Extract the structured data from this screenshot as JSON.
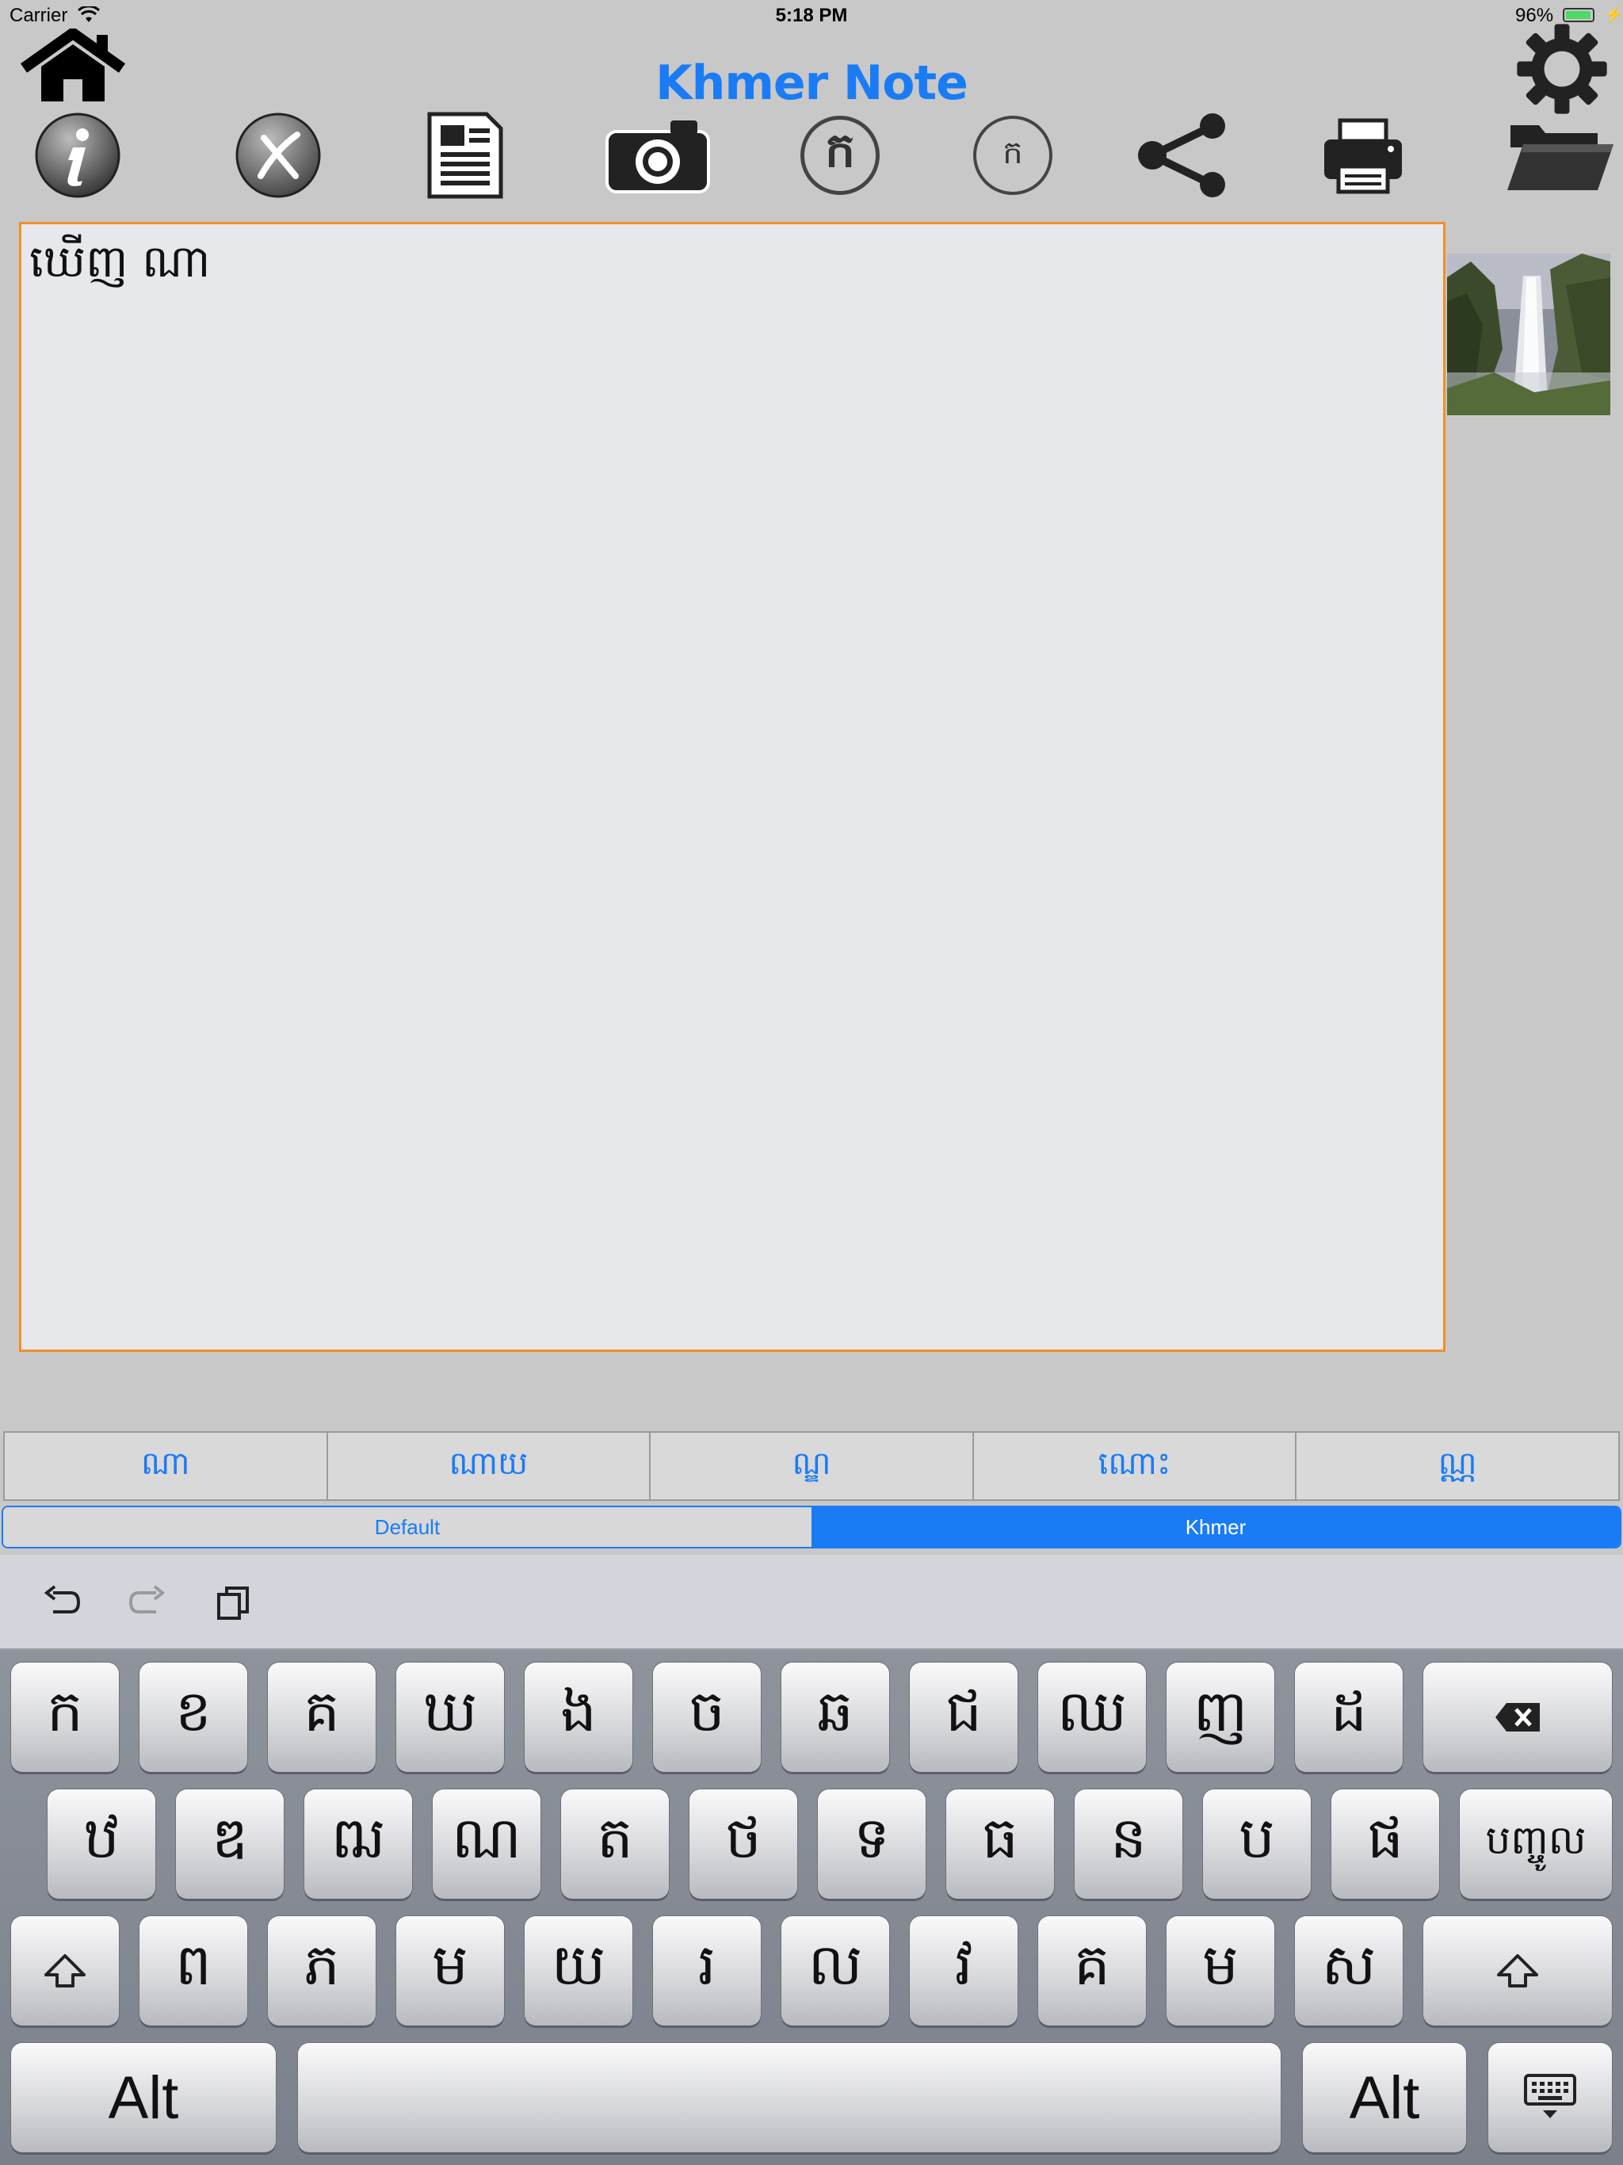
{
  "status_bar": {
    "carrier": "Carrier",
    "time": "5:18 PM",
    "battery": "96%",
    "battery_level": 0.96
  },
  "app": {
    "title": "Khmer Note"
  },
  "toolbar": {
    "icons": [
      "home-icon",
      "settings-gear-icon",
      "info-icon",
      "clear-x-icon",
      "new-document-icon",
      "camera-icon",
      "khmer-font-large-icon",
      "khmer-font-small-icon",
      "share-icon",
      "printer-icon",
      "folder-icon"
    ],
    "khmer_large_glyph": "ក",
    "khmer_small_glyph": "ក"
  },
  "note": {
    "text": "ឃើញ ណា"
  },
  "suggestions": [
    "ណា",
    "ណាយ",
    "ណ្ឌ",
    "ណោះ",
    "ណ្ណ"
  ],
  "keyboard_mode": {
    "options": [
      "Default",
      "Khmer"
    ],
    "selected": "Khmer"
  },
  "keyboard": {
    "toolbar": [
      "undo-icon",
      "redo-icon",
      "paste-icon"
    ],
    "row1": [
      "ក",
      "ខ",
      "គ",
      "ឃ",
      "ង",
      "ច",
      "ឆ",
      "ជ",
      "ឈ",
      "ញ",
      "ដ"
    ],
    "row2": [
      "ឋ",
      "ឌ",
      "ឍ",
      "ណ",
      "ត",
      "ថ",
      "ទ",
      "ធ",
      "ន",
      "ប",
      "ផ"
    ],
    "row2_enter": "បញ្ចូល",
    "row3": [
      "ព",
      "ភ",
      "ម",
      "យ",
      "រ",
      "ល",
      "វ",
      "គ",
      "ម",
      "ស"
    ],
    "alt_left": "Alt",
    "alt_right": "Alt"
  }
}
